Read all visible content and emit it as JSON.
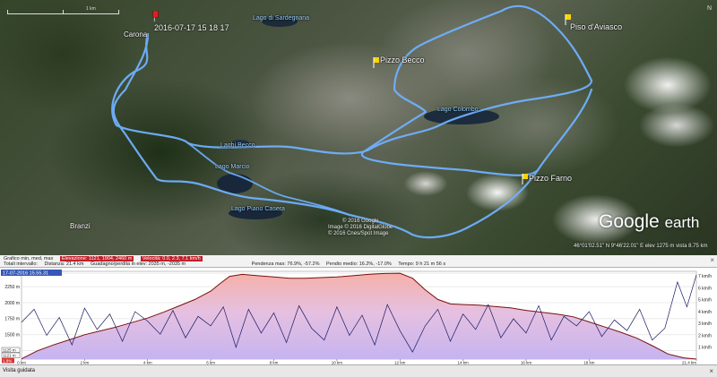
{
  "map": {
    "scale_label": "1 km",
    "timestamp": "2016-07-17 15 18 17",
    "town_labels": [
      "Carona",
      "Branzi"
    ],
    "peak_labels": [
      "Pizzo Becco",
      "Piso d'Aviasco",
      "Pizzo Farno"
    ],
    "lake_labels": [
      "Lago di Sardegnana",
      "Lago Colombo",
      "Laghi Becco",
      "Lago Marcio",
      "Lago Piano Casera"
    ],
    "copyright": [
      "© 2016 Google",
      "Image © 2016 DigitalGlobe",
      "© 2016 Cnes/Spot Image"
    ],
    "logo_google": "Google",
    "logo_earth": "earth",
    "status_bar": "46°01'02.51\" N  9°46'22.01\" E  elev 1275 m   vista  8.75 km",
    "nav": "N",
    "route_color": "#6fb0ff",
    "pin_color": "#ffd400",
    "start_pin_color": "#e02020"
  },
  "profile": {
    "info_row1": {
      "graph_label": "Grafico  min, med, max",
      "elevation_label": "Elevazione:  1121, 1904, 2460 m",
      "speed_label": "Velocità:  0.0, 2.3, 7.1 km/h"
    },
    "info_row2": {
      "totals_label": "Totali intervallo:",
      "distance": "Distanza:  21.4 km",
      "gain": "Guadagno/perdita in elev:  2035 m, -2035 m",
      "slope_max": "Pendenza max:  76.9%,  -57.2%",
      "slope_avg": "Pendio medio:  16.2%,  -17.0%",
      "time": "Tempo:  9 h 21 m 56 s"
    },
    "selected_time": "17-07-2016 15.55.31",
    "close_icon": "×",
    "tour_button": "Visita guidata"
  },
  "chart_data": {
    "type": "area",
    "x_unit": "km",
    "x_ticks": [
      "0 km",
      "2 km",
      "4 km",
      "6 km",
      "8 km",
      "10 km",
      "12 km",
      "14 km",
      "16 km",
      "18 km",
      "21.4 km"
    ],
    "x_tick_values": [
      0,
      2,
      4,
      6,
      8,
      10,
      12,
      14,
      16,
      18,
      21.4
    ],
    "xlim": [
      0,
      21.4
    ],
    "y_left_ticks": [
      "2459 m",
      "2250 m",
      "2000 m",
      "1750 m",
      "1500 m",
      "1250 m"
    ],
    "y_left_values": [
      2459,
      2250,
      2000,
      1750,
      1500,
      1250
    ],
    "ylim_left": [
      1121,
      2460
    ],
    "y_right_ticks": [
      "7 km/h",
      "6 km/h",
      "5 km/h",
      "4 km/h",
      "3 km/h",
      "2 km/h",
      "1 km/h"
    ],
    "y_right_values": [
      7,
      6,
      5,
      4,
      3,
      2,
      1
    ],
    "ylim_right": [
      0,
      7.4
    ],
    "left_min_label_a": "1125 m",
    "left_min_label_b": "1121 m",
    "left_min_label_c": "1.8%",
    "elevation": {
      "x": [
        0,
        0.5,
        1,
        1.5,
        2,
        2.5,
        3,
        3.5,
        4,
        4.5,
        5,
        5.5,
        6,
        6.3,
        6.6,
        7,
        7.5,
        8,
        8.5,
        9,
        9.5,
        10,
        10.5,
        11,
        11.5,
        12,
        12.4,
        12.8,
        13.2,
        13.6,
        14,
        14.5,
        15,
        15.5,
        16,
        16.5,
        17,
        17.5,
        18,
        18.5,
        19,
        19.5,
        20,
        20.5,
        21,
        21.4
      ],
      "y": [
        1125,
        1250,
        1340,
        1420,
        1500,
        1560,
        1620,
        1690,
        1760,
        1850,
        1950,
        2050,
        2180,
        2300,
        2410,
        2440,
        2420,
        2400,
        2380,
        2380,
        2390,
        2400,
        2420,
        2440,
        2455,
        2459,
        2380,
        2200,
        2050,
        1980,
        1970,
        1960,
        1940,
        1920,
        1880,
        1850,
        1820,
        1780,
        1700,
        1620,
        1540,
        1450,
        1330,
        1200,
        1140,
        1121
      ]
    },
    "speed": {
      "x": [
        0,
        0.4,
        0.8,
        1.2,
        1.6,
        2,
        2.4,
        2.8,
        3.2,
        3.6,
        4,
        4.4,
        4.8,
        5.2,
        5.6,
        6,
        6.4,
        6.8,
        7.2,
        7.6,
        8,
        8.4,
        8.8,
        9.2,
        9.6,
        10,
        10.4,
        10.8,
        11.2,
        11.6,
        12,
        12.4,
        12.8,
        13.2,
        13.6,
        14,
        14.4,
        14.8,
        15.2,
        15.6,
        16,
        16.4,
        16.8,
        17.2,
        17.6,
        18,
        18.4,
        18.8,
        19.2,
        19.6,
        20,
        20.4,
        20.8,
        21.1,
        21.4
      ],
      "y": [
        3.1,
        4.2,
        2.0,
        3.5,
        1.2,
        4.3,
        2.5,
        3.8,
        1.5,
        4.0,
        3.2,
        2.1,
        4.1,
        1.8,
        3.6,
        2.8,
        4.4,
        1.0,
        4.2,
        2.2,
        3.9,
        1.4,
        4.5,
        2.6,
        1.6,
        4.4,
        2.0,
        3.7,
        1.2,
        4.6,
        2.4,
        0.6,
        2.8,
        4.2,
        1.5,
        3.8,
        2.5,
        4.6,
        1.8,
        3.4,
        2.2,
        4.5,
        1.6,
        3.6,
        2.8,
        4.0,
        1.9,
        3.3,
        2.4,
        4.2,
        1.6,
        2.6,
        6.5,
        4.4,
        7.1
      ]
    },
    "elevation_fill_color": "#c6b4f0",
    "elevation_fill_high_color": "#f5b0a8",
    "elevation_line_color": "#7a1010",
    "speed_line_color": "#1a1a60"
  }
}
